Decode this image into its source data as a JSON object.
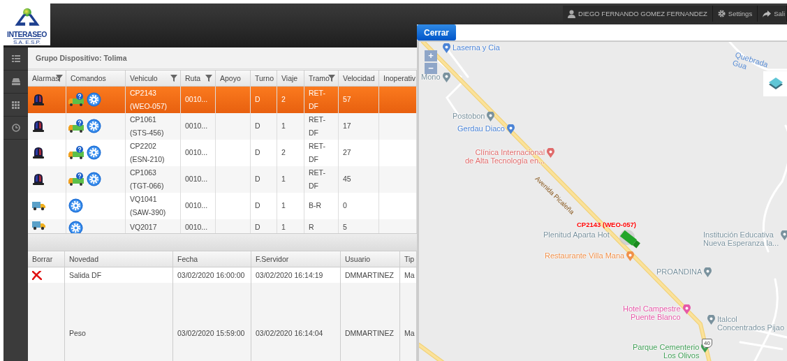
{
  "logo": {
    "name": "INTERASEO",
    "subtitle": "S.A. E.S.P."
  },
  "header": {
    "user": "DIEGO FERNANDO GOMEZ FERNANDEZ",
    "settings": "Settings",
    "logout": "Sali"
  },
  "panel": {
    "title": "Grupo Dispositivo: Tolima"
  },
  "vehicles_table": {
    "columns": [
      {
        "label": "Alarmas",
        "filter": true
      },
      {
        "label": "Comandos",
        "filter": false
      },
      {
        "label": "Vehiculo",
        "filter": true
      },
      {
        "label": "Ruta",
        "filter": true
      },
      {
        "label": "Apoyo",
        "filter": false
      },
      {
        "label": "Turno",
        "filter": false
      },
      {
        "label": "Viaje",
        "filter": false
      },
      {
        "label": "Tramo",
        "filter": true
      },
      {
        "label": "Velocidad",
        "filter": false
      },
      {
        "label": "Inoperativ",
        "filter": false
      }
    ],
    "rows": [
      {
        "selected": true,
        "alarm": {
          "kind": "siren"
        },
        "commands": [
          {
            "kind": "truck-query"
          },
          {
            "kind": "settings"
          }
        ],
        "vehiculo": "CP2143 (WEO-057)",
        "ruta": "0010...",
        "turno": "D",
        "viaje": "2",
        "tramo": "RET-DF",
        "velocidad": "57"
      },
      {
        "selected": false,
        "alarm": {
          "kind": "siren"
        },
        "commands": [
          {
            "kind": "truck-query"
          },
          {
            "kind": "settings"
          }
        ],
        "vehiculo": "CP1061 (STS-456)",
        "ruta": "0010...",
        "turno": "D",
        "viaje": "1",
        "tramo": "RET-DF",
        "velocidad": "17"
      },
      {
        "selected": false,
        "alarm": {
          "kind": "siren"
        },
        "commands": [
          {
            "kind": "truck-query"
          },
          {
            "kind": "settings"
          }
        ],
        "vehiculo": "CP2202 (ESN-210)",
        "ruta": "0010...",
        "turno": "D",
        "viaje": "2",
        "tramo": "RET-DF",
        "velocidad": "27"
      },
      {
        "selected": false,
        "alarm": {
          "kind": "siren"
        },
        "commands": [
          {
            "kind": "truck-query"
          },
          {
            "kind": "settings"
          }
        ],
        "vehiculo": "CP1063 (TGT-066)",
        "ruta": "0010...",
        "turno": "D",
        "viaje": "1",
        "tramo": "RET-DF",
        "velocidad": "45"
      },
      {
        "selected": false,
        "alarm": {
          "kind": "truck"
        },
        "commands": [
          {
            "kind": "settings"
          }
        ],
        "vehiculo": "VQ1041 (SAW-390)",
        "ruta": "0010...",
        "turno": "D",
        "viaje": "1",
        "tramo": "B-R",
        "velocidad": "0"
      },
      {
        "selected": false,
        "alarm": {
          "kind": "truck"
        },
        "commands": [
          {
            "kind": "settings"
          }
        ],
        "vehiculo": "VQ2017",
        "ruta": "0010...",
        "turno": "D",
        "viaje": "1",
        "tramo": "R",
        "velocidad": "5"
      }
    ]
  },
  "events_table": {
    "columns": [
      "Borrar",
      "Novedad",
      "Fecha",
      "F.Servidor",
      "Usuario",
      "Tip"
    ],
    "rows": [
      {
        "deletable": true,
        "novedad": "Salida DF",
        "fecha": "03/02/2020 16:00:00",
        "servidor": "03/02/2020 16:14:19",
        "usuario": "DMMARTINEZ",
        "tipo": "Ma"
      },
      {
        "deletable": false,
        "novedad": "Peso",
        "fecha": "03/02/2020 15:59:00",
        "servidor": "03/02/2020 16:14:04",
        "usuario": "DMMARTINEZ",
        "tipo": "Ma"
      }
    ]
  },
  "map_window": {
    "close_button": "Cerrar",
    "zoom_in": "+",
    "zoom_out": "−",
    "water_label": "Quebrada Gua",
    "road_label": "Avenida Picaleña",
    "highway_shield": "40",
    "vehicle_label": "CP2143 (WEO-057)",
    "places": [
      {
        "lines": [
          "Laserna y Cia"
        ],
        "color": "#4a83d6"
      },
      {
        "lines": [
          "Mono"
        ],
        "color": "#7a929e"
      },
      {
        "lines": [
          "Postobon"
        ],
        "color": "#7a929e"
      },
      {
        "lines": [
          "Gerdau Diaco"
        ],
        "color": "#4a83d6"
      },
      {
        "lines": [
          "Clínica Internacional",
          "de Alta Tecnología en..."
        ],
        "color": "#e06a6a"
      },
      {
        "lines": [
          "Plenitud Aparta Hot"
        ],
        "color": "#7a929e"
      },
      {
        "lines": [
          "Institución Educativa",
          "Nueva Esperanza la..."
        ],
        "color": "#7a929e"
      },
      {
        "lines": [
          "Restaurante Villa Mana"
        ],
        "color": "#f0904a"
      },
      {
        "lines": [
          "PROANDINA"
        ],
        "color": "#7a929e"
      },
      {
        "lines": [
          "Hotel Campestre",
          "Puente Blanco"
        ],
        "color": "#e659a8"
      },
      {
        "lines": [
          "Italcol",
          "Concentrados Pijao"
        ],
        "color": "#7a929e"
      },
      {
        "lines": [
          "Parque Cementerio",
          "Los Olivos"
        ],
        "color": "#3f9e55"
      }
    ]
  }
}
